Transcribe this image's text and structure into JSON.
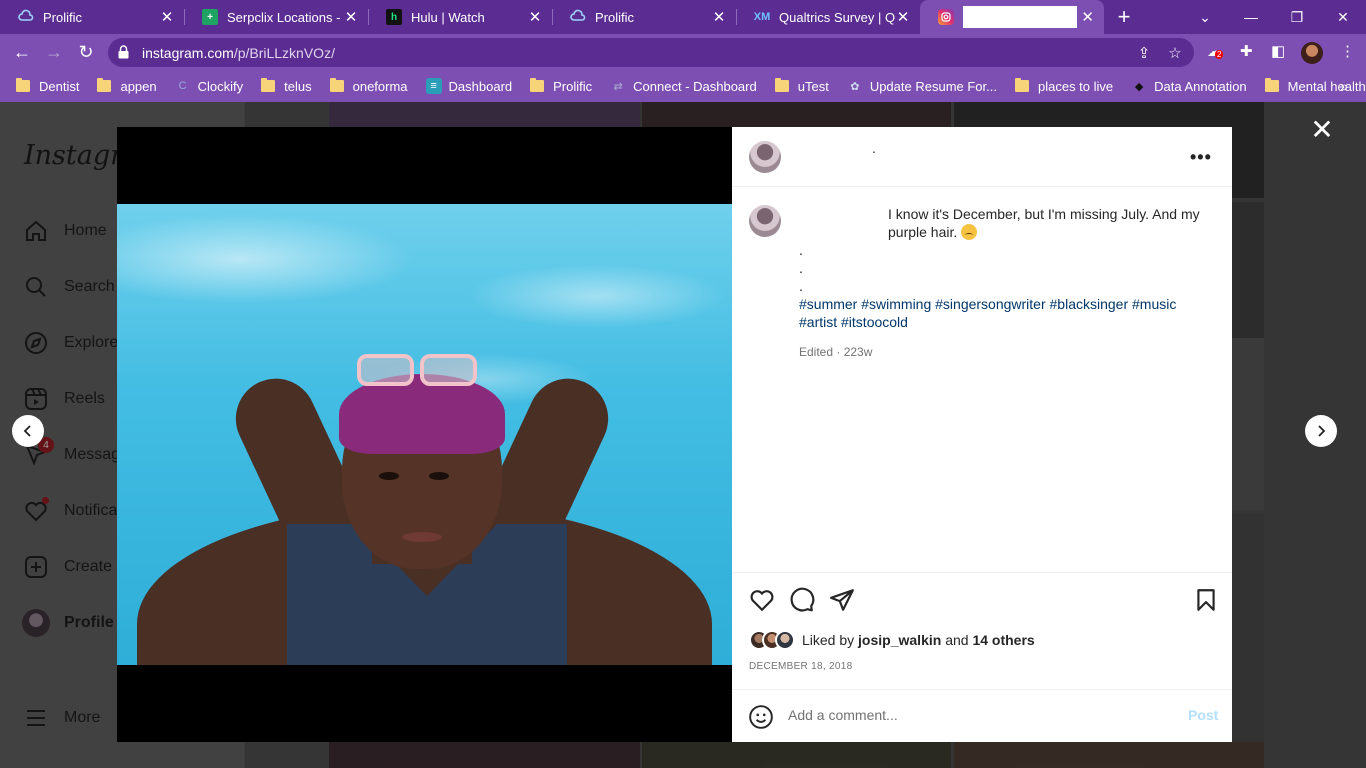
{
  "browser": {
    "tabs": [
      {
        "title": "Prolific",
        "icon": "prolific-icon"
      },
      {
        "title": "Serpclix Locations - Go",
        "icon": "sheets-icon"
      },
      {
        "title": "Hulu | Watch",
        "icon": "hulu-icon"
      },
      {
        "title": "Prolific",
        "icon": "prolific-icon"
      },
      {
        "title": "Qualtrics Survey | Qua",
        "icon": "qualtrics-icon"
      },
      {
        "title": "",
        "icon": "instagram-icon"
      }
    ],
    "url_host": "instagram.com",
    "url_path": "/p/BriLLzknVOz/",
    "extension_badge": "2",
    "bookmarks": [
      "Dentist",
      "appen",
      "Clockify",
      "telus",
      "oneforma",
      "Dashboard",
      "Prolific",
      "Connect - Dashboard",
      "uTest",
      "Update Resume For...",
      "places to live",
      "Data Annotation",
      "Mental health"
    ]
  },
  "instagram": {
    "logo": "Instagram",
    "nav": [
      "Home",
      "Search",
      "Explore",
      "Reels",
      "Messages",
      "Notifications",
      "Create",
      "Profile",
      "More"
    ],
    "messages_badge": "4"
  },
  "post": {
    "header_username": ".",
    "caption_line1": "I know it's December, but I'm missing July. And my purple hair.",
    "dots": [
      ".",
      ".",
      "."
    ],
    "hashtags_line1": "#summer #swimming #singersongwriter #blacksinger #music",
    "hashtags_line2": "#artist #itstoocold",
    "meta": "Edited · 223w",
    "liked_prefix": "Liked by",
    "liked_user": "josip_walkin",
    "liked_and": "and",
    "liked_others": "14 others",
    "date": "DECEMBER 18, 2018",
    "comment_placeholder": "Add a comment...",
    "post_button": "Post"
  },
  "colors": {
    "chrome_dark": "#5b2c92",
    "chrome_light": "#7d4fb3",
    "hashtag": "#00376b",
    "post_button": "#b2dffc"
  }
}
